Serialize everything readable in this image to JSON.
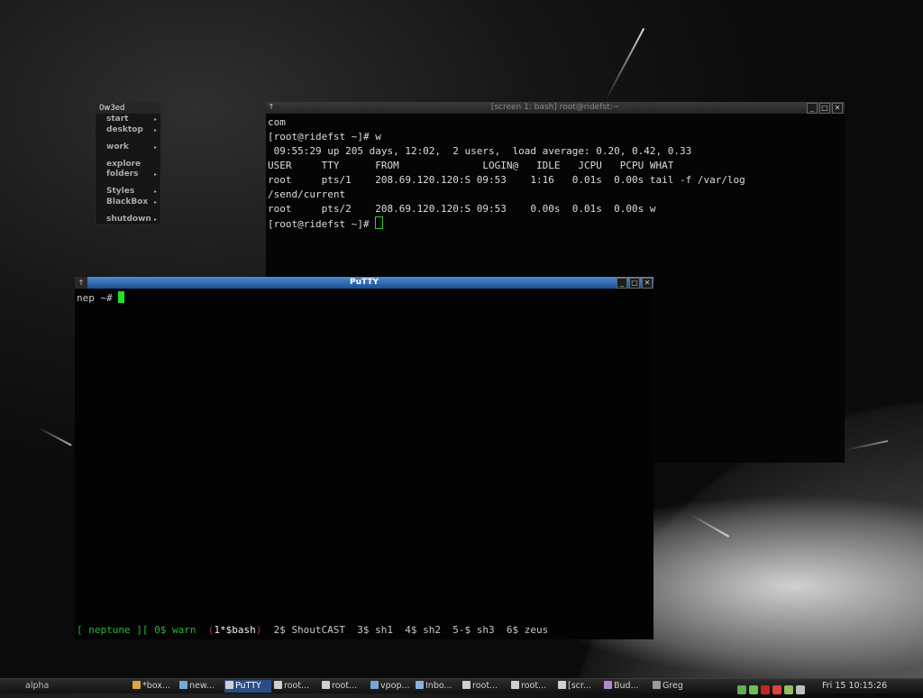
{
  "root_menu": {
    "title": "0w3ed",
    "items": [
      {
        "label": "start"
      },
      {
        "label": "desktop"
      },
      {
        "label": "work"
      },
      {
        "label": "explore"
      },
      {
        "label": "folders"
      },
      {
        "label": "Styles"
      },
      {
        "label": "BlackBox"
      },
      {
        "label": "shutdown"
      }
    ],
    "arrow": "▸"
  },
  "screen_window": {
    "title": "[screen 1: bash] root@ridefst:~",
    "lines": [
      "com",
      "[root@ridefst ~]# w",
      " 09:55:29 up 205 days, 12:02,  2 users,  load average: 0.20, 0.42, 0.33",
      "USER     TTY      FROM              LOGIN@   IDLE   JCPU   PCPU WHAT",
      "root     pts/1    208.69.120.120:S 09:53    1:16   0.01s  0.00s tail -f /var/log",
      "/send/current",
      "root     pts/2    208.69.120.120:S 09:53    0.00s  0.01s  0.00s w",
      "[root@ridefst ~]# "
    ],
    "cursor_color": "#2fcf2f"
  },
  "putty_window": {
    "title": "PuTTY",
    "prompt": "nep ~# ",
    "cursor_color": "#22e022",
    "statusbar": {
      "left_bracket": "[ ",
      "host": "neptune",
      "host_close": " ][ ",
      "w0": "0$ warn",
      "sep1": "  ",
      "open_paren": "(",
      "active": "1*$bash",
      "close_paren": ")",
      "rest": "  2$ ShoutCAST  3$ sh1  4$ sh2  5-$ sh3  6$ zeus"
    }
  },
  "taskbar": {
    "workspace": "alpha",
    "tasks": [
      {
        "label": "*box...",
        "icon_color": "#d9a441",
        "active": false
      },
      {
        "label": "new...",
        "icon_color": "#7aa7d8",
        "active": false
      },
      {
        "label": "PuTTY",
        "icon_color": "#d0d0d0",
        "active": true
      },
      {
        "label": "root...",
        "icon_color": "#d0d0d0",
        "active": false
      },
      {
        "label": "root...",
        "icon_color": "#d0d0d0",
        "active": false
      },
      {
        "label": "vpop...",
        "icon_color": "#7aa7d8",
        "active": false
      },
      {
        "label": "Inbo...",
        "icon_color": "#8fb0d8",
        "active": false
      },
      {
        "label": "root...",
        "icon_color": "#d0d0d0",
        "active": false
      },
      {
        "label": "root...",
        "icon_color": "#d0d0d0",
        "active": false
      },
      {
        "label": "[scr...",
        "icon_color": "#d0d0d0",
        "active": false
      },
      {
        "label": "Bud...",
        "icon_color": "#b08ad0",
        "active": false
      },
      {
        "label": "Greg",
        "icon_color": "#9a9a9a",
        "active": false
      }
    ],
    "tray_icons": [
      {
        "name": "network-icon",
        "color": "#5fae55"
      },
      {
        "name": "messenger-icon",
        "color": "#6fbf4f"
      },
      {
        "name": "opera-icon",
        "color": "#c02828"
      },
      {
        "name": "media-icon",
        "color": "#e04040"
      },
      {
        "name": "grid-icon",
        "color": "#8fbf5f"
      },
      {
        "name": "volume-icon",
        "color": "#bfbfbf"
      }
    ],
    "clock": "Fri 15 10:15:26"
  }
}
